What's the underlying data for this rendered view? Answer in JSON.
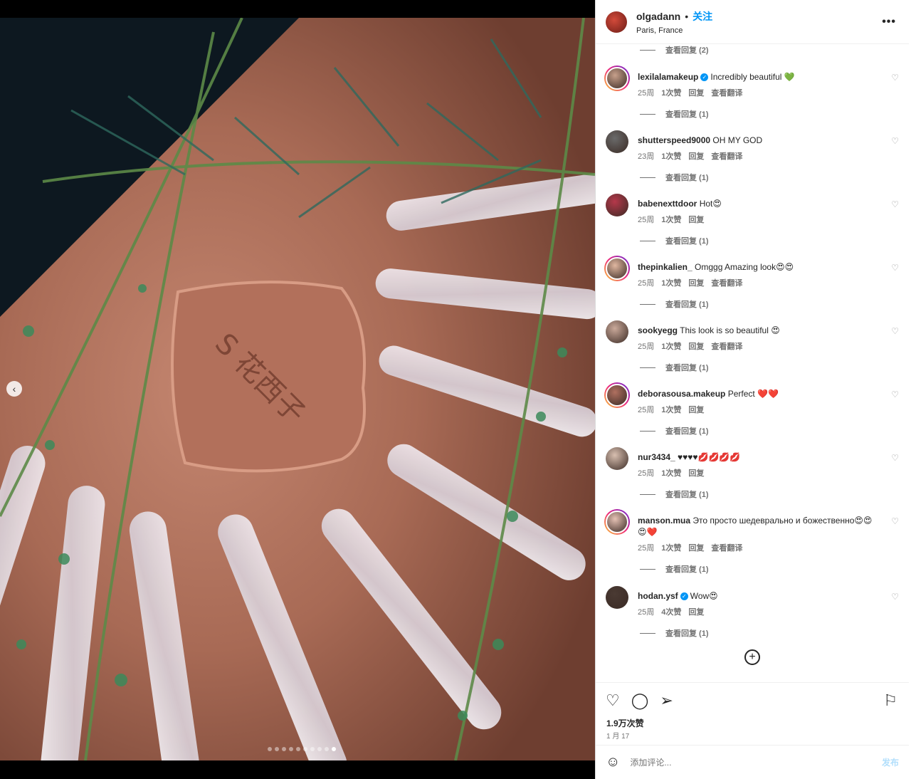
{
  "header": {
    "username": "olgadann",
    "separator": "•",
    "follow_label": "关注",
    "location": "Paris, France",
    "more_label": "•••"
  },
  "comments": [
    {
      "username": "lexilalamakeup",
      "verified": true,
      "text": "Incredibly beautiful 💚",
      "time": "25周",
      "likes": "1次赞",
      "reply": "回复",
      "translate": "查看翻译",
      "view_replies": "查看回复 (1)"
    },
    {
      "username": "shutterspeed9000",
      "verified": false,
      "text": "OH MY GOD",
      "time": "23周",
      "likes": "1次赞",
      "reply": "回复",
      "translate": "查看翻译",
      "view_replies": "查看回复 (1)"
    },
    {
      "username": "babenexttdoor",
      "verified": false,
      "text": "Hot😍",
      "time": "25周",
      "likes": "1次赞",
      "reply": "回复",
      "translate": "",
      "view_replies": "查看回复 (1)"
    },
    {
      "username": "thepinkalien_",
      "verified": false,
      "text": "Omggg Amazing look😍😍",
      "time": "25周",
      "likes": "1次赞",
      "reply": "回复",
      "translate": "查看翻译",
      "view_replies": "查看回复 (1)"
    },
    {
      "username": "sookyegg",
      "verified": false,
      "text": "This look is so beautiful 😍",
      "time": "25周",
      "likes": "1次赞",
      "reply": "回复",
      "translate": "查看翻译",
      "view_replies": "查看回复 (1)"
    },
    {
      "username": "deborasousa.makeup",
      "verified": false,
      "text": "Perfect ❤️❤️",
      "time": "25周",
      "likes": "1次赞",
      "reply": "回复",
      "translate": "",
      "view_replies": "查看回复 (1)"
    },
    {
      "username": "nur3434_",
      "verified": false,
      "text": "♥♥♥♥💋💋💋💋",
      "time": "25周",
      "likes": "1次赞",
      "reply": "回复",
      "translate": "",
      "view_replies": "查看回复 (1)"
    },
    {
      "username": "manson.mua",
      "verified": false,
      "text": "Это просто шедеврально и божественно😍😍😍❤️",
      "time": "25周",
      "likes": "1次赞",
      "reply": "回复",
      "translate": "查看翻译",
      "view_replies": "查看回复 (1)"
    },
    {
      "username": "hodan.ysf",
      "verified": true,
      "text": "Wow😍",
      "time": "25周",
      "likes": "4次赞",
      "reply": "回复",
      "translate": "",
      "view_replies": "查看回复 (1)"
    }
  ],
  "top_view_replies": "查看回复 (2)",
  "actions": {
    "likes_count": "1.9万次赞",
    "date": "1 月 17"
  },
  "comment_box": {
    "placeholder": "添加评论...",
    "post_label": "发布"
  },
  "carousel": {
    "total_slides": 10,
    "active_index": 9
  }
}
